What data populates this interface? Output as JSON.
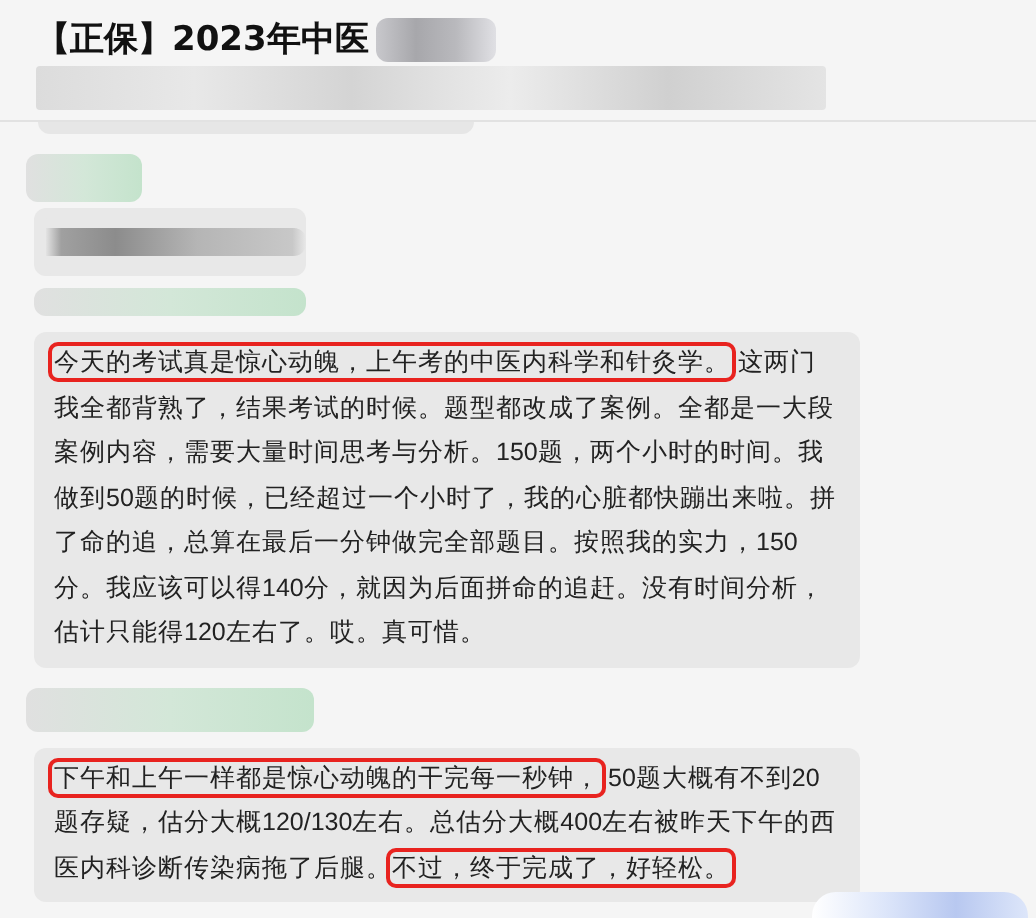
{
  "header": {
    "title": "【正保】2023年中医"
  },
  "messages": [
    {
      "segments": [
        {
          "text": "今天的考试真是惊心动魄，上午考的中医内科学和针灸学。",
          "highlighted": true
        },
        {
          "text": "这两门我全都背熟了，结果考试的时候。题型都改成了案例。全都是一大段案例内容，需要大量时间思考与分析。150题，两个小时的时间。我做到50题的时候，已经超过一个小时了，我的心脏都快蹦出来啦。拼了命的追，总算在最后一分钟做完全部题目。按照我的实力，150分。我应该可以得140分，就因为后面拼命的追赶。没有时间分析，估计只能得120左右了。哎。真可惜。",
          "highlighted": false
        }
      ]
    },
    {
      "segments": [
        {
          "text": "下午和上午一样都是惊心动魄的干完每一秒钟，",
          "highlighted": true
        },
        {
          "text": "50题大概有不到20题存疑，估分大概120/130左右。总估分大概400左右被昨天下午的西医内科诊断传染病拖了后腿。",
          "highlighted": false
        },
        {
          "text": "不过，终于完成了，好轻松。",
          "highlighted": true
        }
      ]
    }
  ]
}
